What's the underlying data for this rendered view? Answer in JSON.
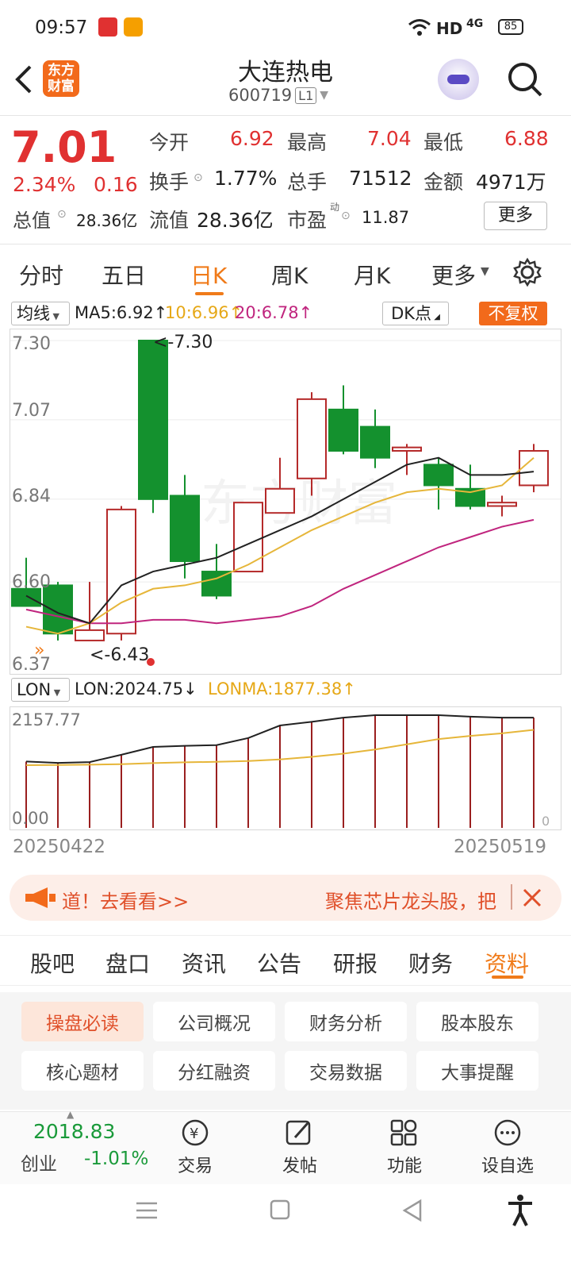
{
  "status": {
    "time": "09:57",
    "net": "HD",
    "sig": "4G",
    "battery": "85"
  },
  "header": {
    "logo": "东方财富",
    "stock_name": "大连热电",
    "stock_code": "600719",
    "level": "L1"
  },
  "quote": {
    "price": "7.01",
    "pct": "2.34%",
    "chg": "0.16",
    "open_label": "今开",
    "open": "6.92",
    "high_label": "最高",
    "high": "7.04",
    "low_label": "最低",
    "low": "6.88",
    "turnover_label": "换手",
    "turnover": "1.77%",
    "vol_label": "总手",
    "vol": "71512",
    "amount_label": "金额",
    "amount": "4971万",
    "mktcap_label": "总值",
    "mktcap": "28.36亿",
    "float_label": "流值",
    "float": "28.36亿",
    "pe_label": "市盈",
    "pe_sup": "动",
    "pe": "11.87",
    "more": "更多"
  },
  "tabs": [
    "分时",
    "五日",
    "日K",
    "周K",
    "月K",
    "更多"
  ],
  "toolbar": {
    "ma_select": "均线",
    "ma5": "MA5:6.92↑",
    "ma10": "10:6.96↑",
    "ma20": "20:6.78↑",
    "dk": "DK点",
    "restore": "不复权"
  },
  "chart_axis": {
    "y1": "7.30",
    "y2": "7.07",
    "y3": "6.84",
    "y4": "6.60",
    "y5": "6.37",
    "max_label": "<-7.30",
    "min_label": "<-6.43",
    "watermark": "东方财富"
  },
  "lon": {
    "select": "LON",
    "value": "LON:2024.75↓",
    "lonma": "LONMA:1877.38↑",
    "top": "2157.77",
    "bottom": "0.00",
    "right_zero": "0"
  },
  "dates": {
    "start": "20250422",
    "end": "20250519"
  },
  "banner": {
    "left": "道！去看看>>",
    "right": "聚焦芯片龙头股，把"
  },
  "subtabs": [
    "股吧",
    "盘口",
    "资讯",
    "公告",
    "研报",
    "财务",
    "资料"
  ],
  "grid": [
    "操盘必读",
    "公司概况",
    "财务分析",
    "股本股东",
    "核心题材",
    "分红融资",
    "交易数据",
    "大事提醒"
  ],
  "bottom": {
    "index_value": "2018.83",
    "index_name": "创业",
    "index_pct": "-1.01%",
    "trade": "交易",
    "post": "发帖",
    "func": "功能",
    "watch": "设自选"
  },
  "chart_data": {
    "type": "candlestick",
    "ylim": [
      6.37,
      7.3
    ],
    "candles": [
      {
        "o": 6.58,
        "c": 6.53,
        "h": 6.67,
        "l": 6.53
      },
      {
        "o": 6.59,
        "c": 6.45,
        "h": 6.6,
        "l": 6.43
      },
      {
        "o": 6.43,
        "c": 6.46,
        "h": 6.6,
        "l": 6.43
      },
      {
        "o": 6.45,
        "c": 6.81,
        "h": 6.82,
        "l": 6.43
      },
      {
        "o": 7.3,
        "c": 6.84,
        "h": 7.3,
        "l": 6.8
      },
      {
        "o": 6.85,
        "c": 6.66,
        "h": 6.91,
        "l": 6.61
      },
      {
        "o": 6.63,
        "c": 6.56,
        "h": 6.71,
        "l": 6.55
      },
      {
        "o": 6.63,
        "c": 6.83,
        "h": 6.83,
        "l": 6.63
      },
      {
        "o": 6.8,
        "c": 6.87,
        "h": 6.96,
        "l": 6.8
      },
      {
        "o": 6.9,
        "c": 7.13,
        "h": 7.15,
        "l": 6.85
      },
      {
        "o": 7.1,
        "c": 6.98,
        "h": 7.17,
        "l": 6.97
      },
      {
        "o": 7.05,
        "c": 6.96,
        "h": 7.1,
        "l": 6.93
      },
      {
        "o": 6.98,
        "c": 6.99,
        "h": 7.0,
        "l": 6.91
      },
      {
        "o": 6.94,
        "c": 6.88,
        "h": 6.96,
        "l": 6.81
      },
      {
        "o": 6.87,
        "c": 6.82,
        "h": 6.94,
        "l": 6.81
      },
      {
        "o": 6.82,
        "c": 6.83,
        "h": 6.85,
        "l": 6.79
      },
      {
        "o": 6.88,
        "c": 6.98,
        "h": 7.0,
        "l": 6.86
      }
    ],
    "ma5": [
      6.56,
      6.51,
      6.48,
      6.59,
      6.63,
      6.65,
      6.67,
      6.71,
      6.75,
      6.79,
      6.84,
      6.89,
      6.94,
      6.96,
      6.91,
      6.91,
      6.92
    ],
    "ma10": [
      6.47,
      6.45,
      6.48,
      6.54,
      6.58,
      6.59,
      6.61,
      6.65,
      6.7,
      6.75,
      6.79,
      6.83,
      6.86,
      6.87,
      6.86,
      6.88,
      6.96
    ],
    "ma20": [
      6.52,
      6.5,
      6.48,
      6.48,
      6.49,
      6.49,
      6.48,
      6.49,
      6.5,
      6.53,
      6.58,
      6.62,
      6.66,
      6.7,
      6.73,
      6.76,
      6.78
    ],
    "lon": [
      1270,
      1245,
      1260,
      1400,
      1550,
      1570,
      1585,
      1720,
      1960,
      2030,
      2110,
      2157,
      2157,
      2157,
      2130,
      2110,
      2110
    ],
    "lonma": [
      1200,
      1205,
      1210,
      1220,
      1240,
      1255,
      1265,
      1280,
      1310,
      1360,
      1420,
      1500,
      1600,
      1700,
      1760,
      1810,
      1877
    ]
  }
}
